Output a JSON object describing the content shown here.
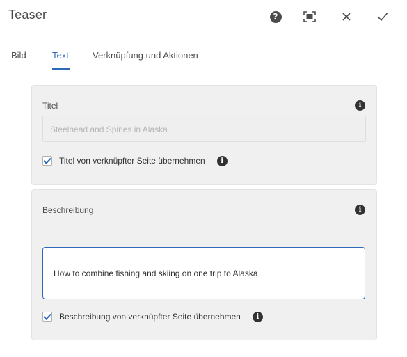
{
  "header": {
    "title": "Teaser",
    "icons": [
      "help-icon",
      "fullscreen-icon",
      "close-icon",
      "done-icon"
    ]
  },
  "tabs": [
    {
      "label": "Bild",
      "active": false
    },
    {
      "label": "Text",
      "active": true
    },
    {
      "label": "Verknüpfung und Aktionen",
      "active": false
    }
  ],
  "title_section": {
    "label": "Titel",
    "input_value": "Steelhead and Spines in Alaska",
    "input_disabled": true,
    "checkbox_label": "Titel von verknüpfter Seite übernehmen",
    "checkbox_checked": true
  },
  "description_section": {
    "label": "Beschreibung",
    "textarea_value": "How to combine fishing and skiing on one trip to Alaska",
    "checkbox_label": "Beschreibung von verknüpfter Seite übernehmen",
    "checkbox_checked": true
  },
  "colors": {
    "accent": "#2c6ab7",
    "panel_bg": "#f0f0f0"
  }
}
